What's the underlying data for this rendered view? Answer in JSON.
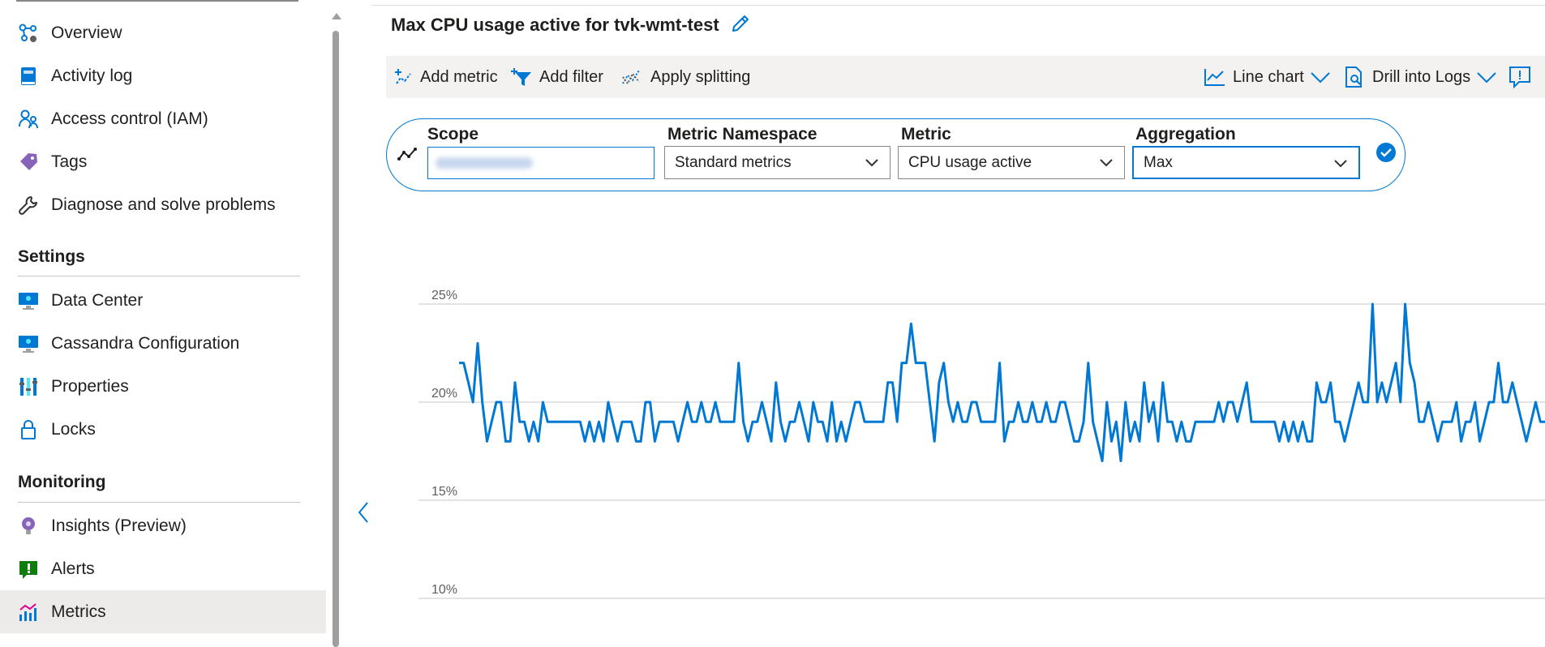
{
  "sidebar": {
    "items_top": [
      {
        "label": "Overview",
        "icon": "overview-icon"
      },
      {
        "label": "Activity log",
        "icon": "activity-log-icon"
      },
      {
        "label": "Access control (IAM)",
        "icon": "access-control-icon"
      },
      {
        "label": "Tags",
        "icon": "tag-icon"
      },
      {
        "label": "Diagnose and solve problems",
        "icon": "wrench-icon"
      }
    ],
    "settings": {
      "title": "Settings",
      "items": [
        {
          "label": "Data Center",
          "icon": "monitor-icon"
        },
        {
          "label": "Cassandra Configuration",
          "icon": "monitor-icon"
        },
        {
          "label": "Properties",
          "icon": "properties-icon"
        },
        {
          "label": "Locks",
          "icon": "lock-icon"
        }
      ]
    },
    "monitoring": {
      "title": "Monitoring",
      "items": [
        {
          "label": "Insights (Preview)",
          "icon": "lightbulb-icon"
        },
        {
          "label": "Alerts",
          "icon": "alert-icon"
        },
        {
          "label": "Metrics",
          "icon": "metrics-icon",
          "selected": true
        }
      ]
    }
  },
  "chart_title": "Max CPU usage active for tvk-wmt-test",
  "toolbar": {
    "add_metric": "Add metric",
    "add_filter": "Add filter",
    "apply_splitting": "Apply splitting",
    "line_chart": "Line chart",
    "drill_into_logs": "Drill into Logs"
  },
  "metric_selector": {
    "scope_label": "Scope",
    "scope_value": "",
    "namespace_label": "Metric Namespace",
    "namespace_value": "Standard metrics",
    "metric_label": "Metric",
    "metric_value": "CPU usage active",
    "aggregation_label": "Aggregation",
    "aggregation_value": "Max"
  },
  "colors": {
    "accent": "#0078d4",
    "series": "#0078d4",
    "grid": "#c8c6c4",
    "selected_nav": "#edebe9"
  },
  "chart_data": {
    "type": "line",
    "title": "Max CPU usage active for tvk-wmt-test",
    "ylim": [
      10,
      25
    ],
    "yticks": [
      "25%",
      "20%",
      "15%",
      "10%"
    ],
    "grid": true,
    "series": [
      {
        "values": [
          22,
          22,
          21,
          20,
          23,
          20,
          18,
          19,
          20,
          20,
          18,
          18,
          21,
          19,
          19,
          18,
          19,
          18,
          20,
          19,
          19,
          19,
          19,
          19,
          19,
          19,
          19,
          18,
          19,
          18,
          19,
          18,
          20,
          19,
          18,
          19,
          19,
          19,
          18,
          18,
          20,
          20,
          18,
          19,
          19,
          19,
          19,
          18,
          19,
          20,
          19,
          19,
          20,
          19,
          19,
          20,
          19,
          19,
          19,
          19,
          22,
          19,
          18,
          19,
          19,
          20,
          19,
          18,
          21,
          19,
          18,
          19,
          19,
          20,
          19,
          18,
          20,
          19,
          19,
          18,
          20,
          18,
          19,
          18,
          19,
          20,
          20,
          19,
          19,
          19,
          19,
          19,
          21,
          21,
          19,
          22,
          22,
          24,
          22,
          22,
          22,
          20,
          18,
          21,
          22,
          20,
          19,
          20,
          19,
          19,
          20,
          20,
          19,
          19,
          19,
          19,
          22,
          18,
          19,
          19,
          20,
          19,
          19,
          20,
          19,
          19,
          20,
          19,
          19,
          20,
          20,
          19,
          18,
          18,
          19,
          22,
          19,
          18,
          17,
          20,
          18,
          19,
          17,
          20,
          18,
          19,
          18,
          21,
          19,
          20,
          18,
          21,
          19,
          19,
          18,
          19,
          18,
          18,
          19,
          19,
          19,
          19,
          19,
          20,
          19,
          20,
          20,
          19,
          20,
          21,
          19,
          19,
          19,
          19,
          19,
          19,
          18,
          19,
          18,
          19,
          18,
          19,
          18,
          18,
          21,
          20,
          20,
          21,
          19,
          19,
          18,
          19,
          20,
          21,
          20,
          20,
          25,
          20,
          21,
          20,
          21,
          22,
          20,
          25,
          22,
          21,
          19,
          19,
          20,
          19,
          18,
          19,
          19,
          19,
          20,
          18,
          19,
          19,
          20,
          18,
          19,
          20,
          20,
          22,
          20,
          20,
          21,
          20,
          19,
          18,
          19,
          20,
          19,
          19
        ]
      }
    ]
  }
}
